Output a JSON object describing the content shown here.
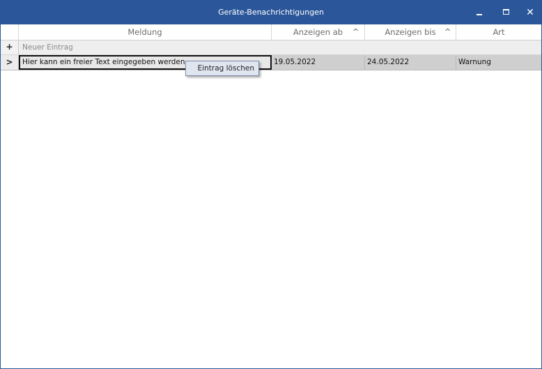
{
  "window": {
    "title": "Geräte-Benachrichtigungen",
    "close_glyph": "✕",
    "accent": "#2b579a"
  },
  "grid": {
    "columns": [
      {
        "label": "Meldung",
        "sort": ""
      },
      {
        "label": "Anzeigen ab",
        "sort": "^"
      },
      {
        "label": "Anzeigen bis",
        "sort": "^"
      },
      {
        "label": "Art",
        "sort": ""
      }
    ],
    "new_row": {
      "indicator": "+",
      "label": "Neuer Eintrag"
    },
    "rows": [
      {
        "indicator": ">",
        "meldung": "Hier kann ein freier Text eingegeben werden.",
        "anzeigen_ab": "19.05.2022",
        "anzeigen_bis": "24.05.2022",
        "art": "Warnung"
      }
    ]
  },
  "context_menu": {
    "items": [
      "Eintrag löschen"
    ]
  }
}
